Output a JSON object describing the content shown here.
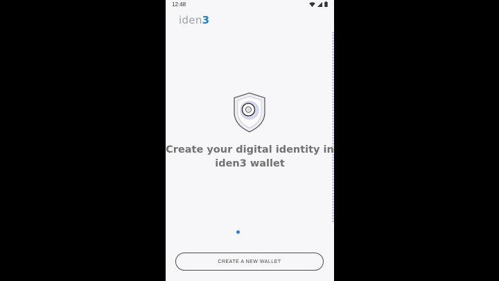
{
  "status_bar": {
    "time": "12:48",
    "icons": [
      "wifi-icon",
      "signal-icon",
      "battery-icon"
    ]
  },
  "logo": {
    "text": "iden",
    "number": "3"
  },
  "headline": "Create your digital identity in iden3 wallet",
  "pager": {
    "pages": 1,
    "active": 1
  },
  "cta": {
    "label": "CREATE A NEW WALLET"
  },
  "colors": {
    "background": "#f7f7f9",
    "accent": "#2e7bd6",
    "headline": "#717171",
    "logo_text": "#9aa0a6",
    "logo_number": "#1e7fd0"
  }
}
